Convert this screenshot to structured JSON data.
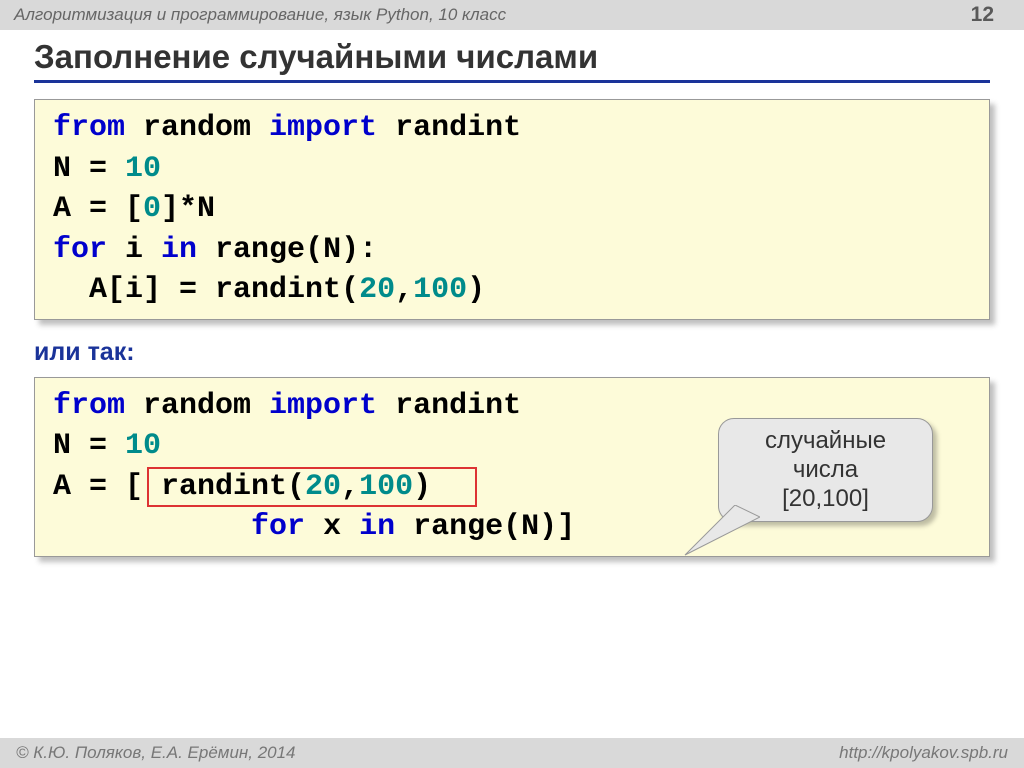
{
  "header": {
    "breadcrumb": "Алгоритмизация и программирование, язык Python, 10 класс",
    "page": "12"
  },
  "title": "Заполнение случайными числами",
  "code1": {
    "l1_kw1": "from",
    "l1_t1": " random ",
    "l1_kw2": "import",
    "l1_t2": " randint",
    "l2_t1": "N = ",
    "l2_n1": "10",
    "l3_t1": "A = [",
    "l3_n1": "0",
    "l3_t2": "]*N",
    "l4_kw1": "for",
    "l4_t1": " i ",
    "l4_kw2": "in",
    "l4_t2": " range(N):",
    "l5_t1": "  A[i] = randint(",
    "l5_n1": "20",
    "l5_t2": ",",
    "l5_n2": "100",
    "l5_t3": ")"
  },
  "between": "или так:",
  "code2": {
    "l1_kw1": "from",
    "l1_t1": " random ",
    "l1_kw2": "import",
    "l1_t2": " randint",
    "l2_t1": "N = ",
    "l2_n1": "10",
    "l3_t1": "A = [ randint(",
    "l3_n1": "20",
    "l3_t2": ",",
    "l3_n2": "100",
    "l3_t3": ") ",
    "l4_t1": "           ",
    "l4_kw1": "for",
    "l4_t2": " x ",
    "l4_kw2": "in",
    "l4_t3": " range(N)]"
  },
  "callout": {
    "line1": "случайные",
    "line2": "числа",
    "line3": "[20,100]"
  },
  "footer": {
    "left": "© К.Ю. Поляков, Е.А. Ерёмин, 2014",
    "right": "http://kpolyakov.spb.ru"
  }
}
